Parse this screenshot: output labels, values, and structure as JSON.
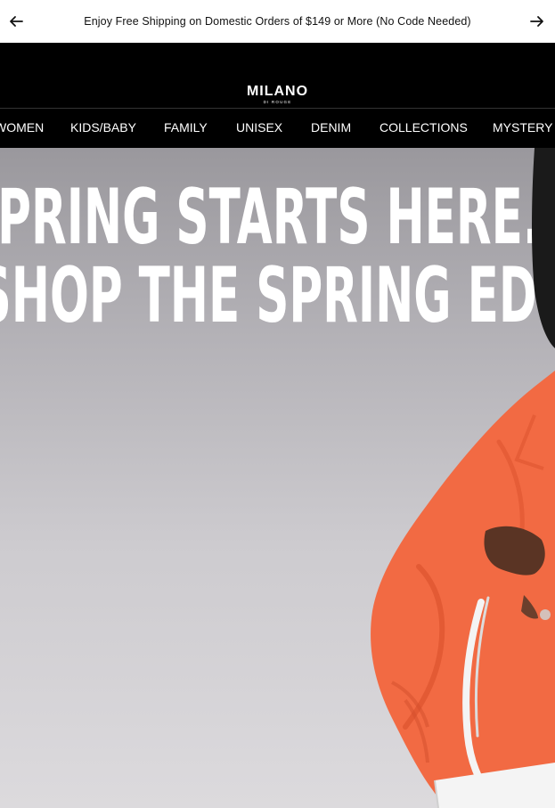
{
  "announcement": {
    "message": "Enjoy Free Shipping on Domestic Orders of $149 or More (No Code Needed)",
    "prev_icon": "arrow-left-icon",
    "next_icon": "arrow-right-icon"
  },
  "header": {
    "logo_main": "MILANO",
    "logo_sub": "DI ROUGE",
    "nav": [
      "WOMEN",
      "KIDS/BABY",
      "FAMILY",
      "UNISEX",
      "DENIM",
      "COLLECTIONS",
      "MYSTERY"
    ]
  },
  "hero": {
    "headline_line1": "SPRING STARTS HERE.",
    "headline_line2": "SHOP THE SPRING EDIT.",
    "colors": {
      "background": "#c4c2c6",
      "jacket": "#f26a43",
      "bag": "#ffffff"
    }
  }
}
